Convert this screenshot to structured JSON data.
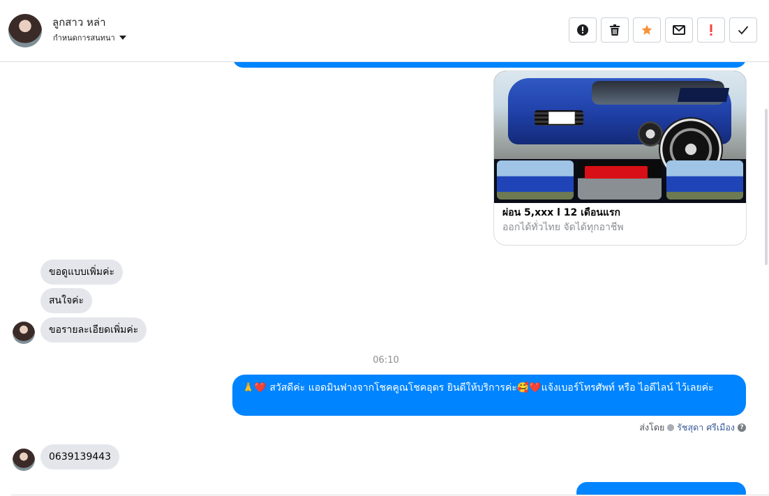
{
  "header": {
    "contact_name": "ลูกสาว หล่า",
    "assign_label": "กำหนดการสนทนา",
    "actions": [
      {
        "name": "report-spam-button",
        "icon": "alert-circle-icon"
      },
      {
        "name": "delete-button",
        "icon": "trash-icon"
      },
      {
        "name": "star-button",
        "icon": "star-icon",
        "color": "#f7923a"
      },
      {
        "name": "mark-unread-button",
        "icon": "envelope-icon"
      },
      {
        "name": "follow-up-button",
        "icon": "exclamation-icon",
        "color": "#fa3e3e"
      },
      {
        "name": "mark-done-button",
        "icon": "check-icon"
      }
    ]
  },
  "conversation": {
    "link_card": {
      "title": "ผ่อน 5,xxx l 12 เดือนแรก",
      "subtitle": "ออกได้ทั่วไทย จัดได้ทุกอาชีพ"
    },
    "incoming_1": [
      "ขอดูแบบเพิ่มค่ะ",
      "สนใจค่ะ",
      "ขอรายละเอียดเพิ่มค่ะ"
    ],
    "timestamp": "06:10",
    "outgoing_text": "🙏❤️ สวัสดีค่ะ แอดมินฟางจากโชคคูณโชคอุดร ยินดีให้บริการค่ะ🥰❤️แจ้งเบอร์โทรศัพท์ หรือ ไอดีไลน์  ไว้เลยค่ะ",
    "sent_by_label": "ส่งโดย",
    "sent_by_agent": "รัชสุดา ศรีเมือง",
    "incoming_2": "0639139443"
  },
  "colors": {
    "outgoing_bubble": "#0084ff",
    "incoming_bubble": "#e4e6eb",
    "star": "#f7923a",
    "alert": "#fa3e3e"
  }
}
